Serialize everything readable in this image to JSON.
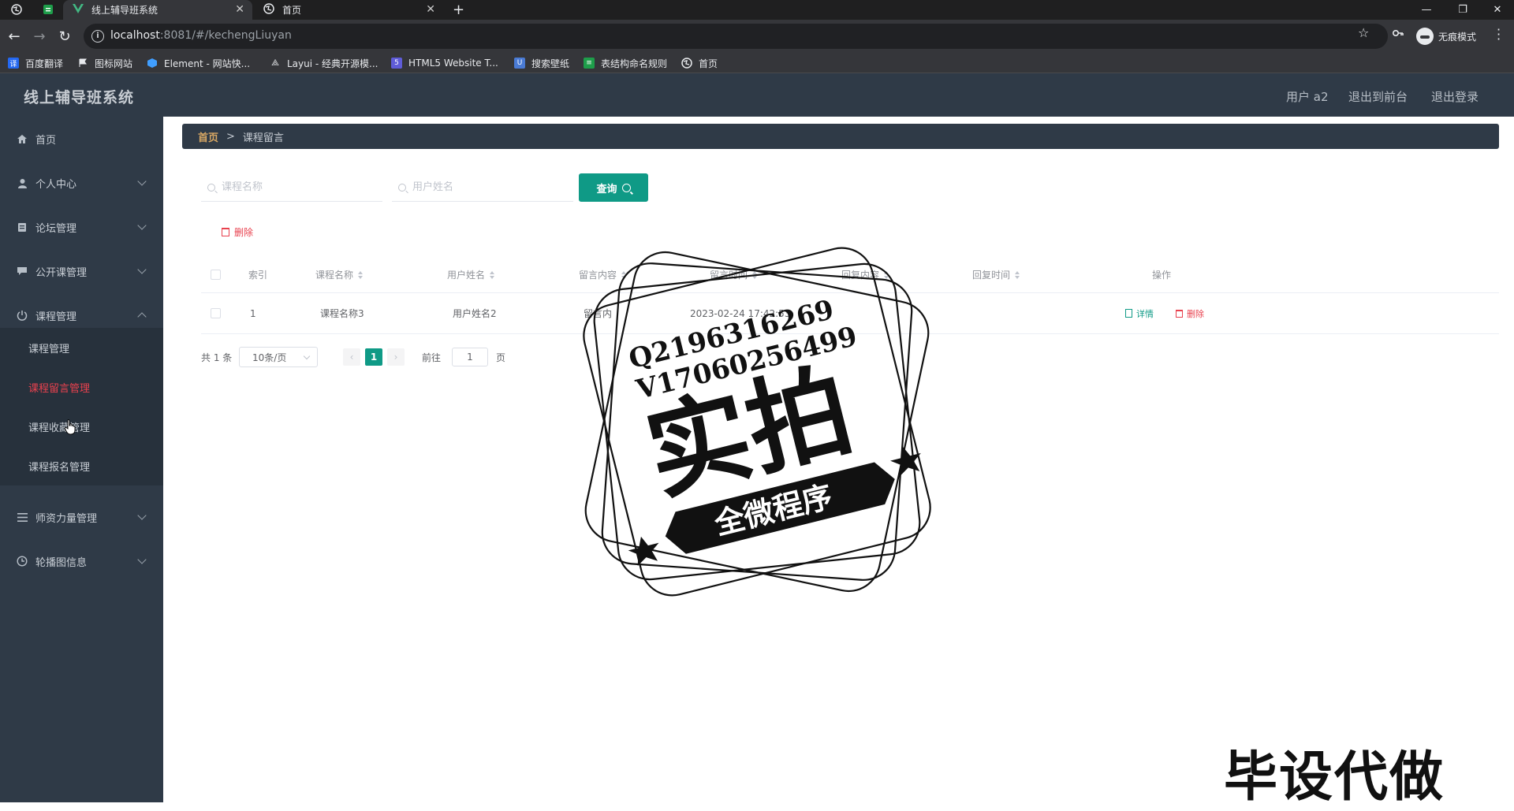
{
  "browser": {
    "tabs": [
      {
        "title": "线上辅导班系统",
        "active": true
      },
      {
        "title": "首页",
        "active": false
      }
    ],
    "new_tab": "+",
    "url_host": "localhost",
    "url_rest": ":8081/#/kechengLiuyan",
    "incognito_label": "无痕模式",
    "bookmarks": [
      {
        "label": "百度翻译",
        "icon": "translate-icon",
        "color": "#2468f2"
      },
      {
        "label": "图标网站",
        "icon": "flag-icon",
        "color": "#e8eaed"
      },
      {
        "label": "Element - 网站快...",
        "icon": "element-icon",
        "color": "#409eff"
      },
      {
        "label": "Layui - 经典开源模...",
        "icon": "layui-icon",
        "color": "#e8eaed"
      },
      {
        "label": "HTML5 Website T...",
        "icon": "html5-icon",
        "color": "#5f5cd8"
      },
      {
        "label": "搜索壁纸",
        "icon": "wallpaper-icon",
        "color": "#4a7bd5"
      },
      {
        "label": "表结构命名规则",
        "icon": "doc-icon",
        "color": "#1e9e4a"
      },
      {
        "label": "首页",
        "icon": "globe-icon",
        "color": "#e8eaed"
      }
    ]
  },
  "header": {
    "title": "线上辅导班系统",
    "user": "用户 a2",
    "to_front": "退出到前台",
    "logout": "退出登录"
  },
  "sidebar": {
    "items": [
      {
        "label": "首页",
        "icon": "home-icon",
        "expandable": false
      },
      {
        "label": "个人中心",
        "icon": "user-icon",
        "expandable": true
      },
      {
        "label": "论坛管理",
        "icon": "forum-icon",
        "expandable": true
      },
      {
        "label": "公开课管理",
        "icon": "chat-icon",
        "expandable": true
      },
      {
        "label": "课程管理",
        "icon": "power-icon",
        "expandable": true,
        "expanded": true
      },
      {
        "label": "师资力量管理",
        "icon": "list-icon",
        "expandable": true
      },
      {
        "label": "轮播图信息",
        "icon": "clock-icon",
        "expandable": true
      }
    ],
    "submenu": [
      {
        "label": "课程管理",
        "active": false
      },
      {
        "label": "课程留言管理",
        "active": true
      },
      {
        "label": "课程收藏管理",
        "active": false
      },
      {
        "label": "课程报名管理",
        "active": false
      }
    ]
  },
  "breadcrumb": {
    "home": "首页",
    "separator": ">",
    "current": "课程留言"
  },
  "search": {
    "course_placeholder": "课程名称",
    "user_placeholder": "用户姓名",
    "query_label": "查询"
  },
  "actions": {
    "delete_label": "删除"
  },
  "table": {
    "columns": [
      "索引",
      "课程名称",
      "用户姓名",
      "留言内容",
      "留言时间",
      "回复内容",
      "回复时间",
      "操作"
    ],
    "rows": [
      {
        "index": "1",
        "course": "课程名称3",
        "user": "用户姓名2",
        "message": "留言内",
        "time": "2023-02-24 17:42:53",
        "reply": "",
        "reply_time": ""
      }
    ],
    "row_actions": {
      "detail": "详情",
      "delete": "删除"
    }
  },
  "pagination": {
    "total": "共 1 条",
    "page_size": "10条/页",
    "current_page": "1",
    "goto_prefix": "前往",
    "goto_value": "1",
    "goto_suffix": "页"
  },
  "watermark": {
    "contact_q": "Q2196316269",
    "contact_v": "V17060256499",
    "big": "实拍",
    "ribbon": "全微程序",
    "corner": "毕设代做"
  },
  "colors": {
    "sidebar_bg": "#2f3a47",
    "accent_teal": "#0f9a86",
    "danger_red": "#e8414e",
    "breadcrumb_home": "#d9a864"
  }
}
